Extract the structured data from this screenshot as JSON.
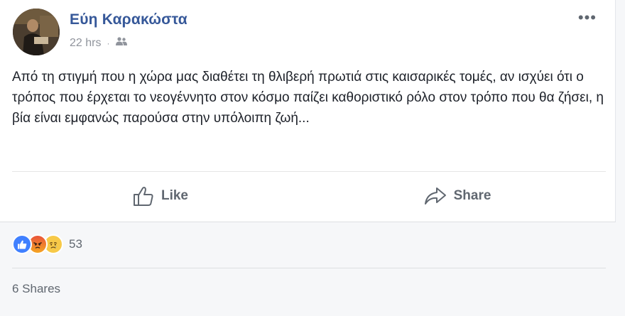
{
  "post": {
    "author": "Εύη Καρακώστα",
    "time": "22 hrs",
    "separator": "·",
    "audience_icon": "friends-icon",
    "more_label": "•••",
    "text": "Από τη στιγμή που η χώρα μας διαθέτει τη θλιβερή πρωτιά στις καισαρικές τομές, αν ισχύει ότι ο τρόπος που έρχεται το νεογέννητο στον κόσμο παίζει καθοριστικό ρόλο στον τρόπο που θα ζήσει, η βία είναι εμφανώς παρούσα στην υπόλοιπη ζωή..."
  },
  "actions": {
    "like_label": "Like",
    "share_label": "Share"
  },
  "reactions": {
    "types": [
      "like",
      "angry",
      "sad"
    ],
    "count": "53"
  },
  "shares": {
    "label": "6 Shares"
  },
  "colors": {
    "author_link": "#365899",
    "secondary_text": "#606770",
    "meta_text": "#90949c",
    "like_blue": "#4080ff"
  }
}
